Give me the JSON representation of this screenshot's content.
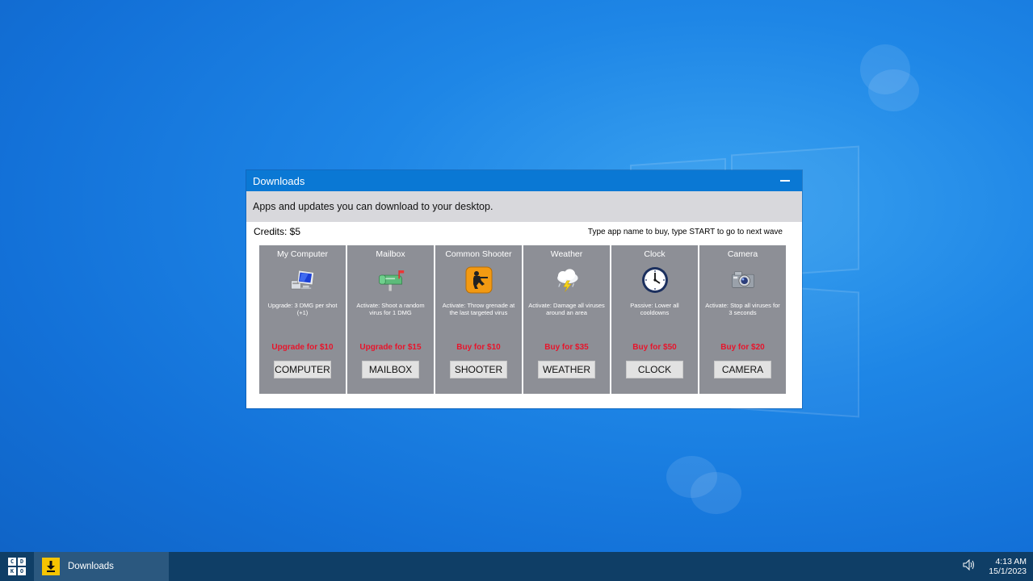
{
  "window": {
    "title": "Downloads",
    "subtitle": "Apps and updates you can download to your desktop.",
    "credits": "Credits: $5",
    "hint": "Type app name to buy, type START to go to next wave"
  },
  "cards": [
    {
      "title": "My Computer",
      "icon": "computer-icon",
      "desc": "Upgrade: 3 DMG per shot (+1)",
      "price": "Upgrade for $10",
      "button": "COMPUTER"
    },
    {
      "title": "Mailbox",
      "icon": "mailbox-icon",
      "desc": "Activate: Shoot a random virus for 1 DMG",
      "price": "Upgrade for $15",
      "button": "MAILBOX"
    },
    {
      "title": "Common Shooter",
      "icon": "shooter-icon",
      "desc": "Activate: Throw grenade at the last targeted virus",
      "price": "Buy for $10",
      "button": "SHOOTER"
    },
    {
      "title": "Weather",
      "icon": "weather-icon",
      "desc": "Activate: Damage all viruses around an area",
      "price": "Buy for $35",
      "button": "WEATHER"
    },
    {
      "title": "Clock",
      "icon": "clock-icon",
      "desc": "Passive: Lower all cooldowns",
      "price": "Buy for $50",
      "button": "CLOCK"
    },
    {
      "title": "Camera",
      "icon": "camera-icon",
      "desc": "Activate: Stop all viruses for 3 seconds",
      "price": "Buy for $20",
      "button": "CAMERA"
    }
  ],
  "taskbar": {
    "start_letters": [
      "C",
      "D",
      "K",
      "O"
    ],
    "task_label": "Downloads",
    "time": "4:13 AM",
    "date": "15/1/2023"
  },
  "colors": {
    "titlebar": "#0a78d4",
    "card": "#8d8f96",
    "price": "#e8142b",
    "taskbar": "#0f3e66"
  }
}
